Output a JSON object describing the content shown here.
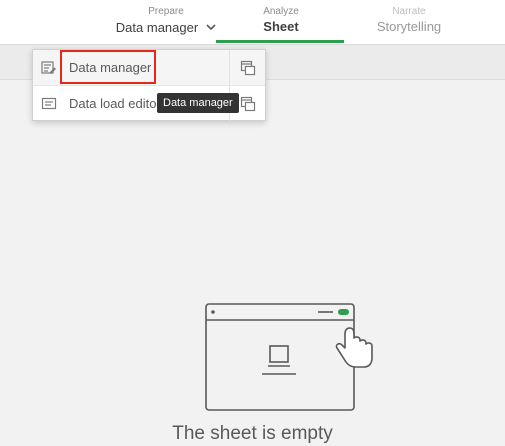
{
  "nav": {
    "prepare": {
      "sub": "Prepare",
      "main": "Data manager"
    },
    "analyze": {
      "sub": "Analyze",
      "main": "Sheet"
    },
    "narrate": {
      "sub": "Narrate",
      "main": "Storytelling"
    }
  },
  "dropdown": {
    "items": [
      {
        "label": "Data manager",
        "icon": "data-manager-icon"
      },
      {
        "label": "Data load editor",
        "icon": "data-load-editor-icon"
      }
    ]
  },
  "tooltip": {
    "text": "Data manager"
  },
  "sheet": {
    "empty_message": "The sheet is empty"
  },
  "colors": {
    "accent": "#2e9e4f",
    "highlight": "#e8261a",
    "tooltip_bg": "#333333"
  }
}
